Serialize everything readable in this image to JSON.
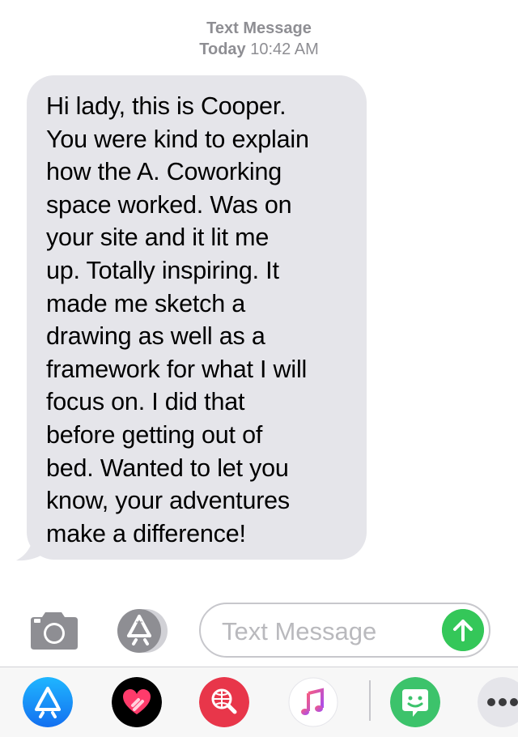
{
  "header": {
    "service": "Text Message",
    "day": "Today",
    "time": "10:42 AM"
  },
  "message": {
    "sender": "incoming",
    "text": "Hi lady, this is Cooper.\nYou were kind to explain\nhow the A. Coworking\nspace worked. Was on\nyour site and it lit me\nup. Totally inspiring. It\nmade me sketch a\ndrawing as well as a\nframework for what I will\nfocus on. I did that\nbefore getting out of\nbed. Wanted to let you\nknow, your adventures\nmake a difference!"
  },
  "composer": {
    "placeholder": "Text Message",
    "camera_icon": "camera-icon",
    "apps_icon": "app-store-icon",
    "send_icon": "arrow-up-icon",
    "send_color": "#34c759"
  },
  "app_drawer": {
    "apps": [
      {
        "icon": "app-store-icon",
        "color": "#1a8cff"
      },
      {
        "icon": "digital-touch-icon",
        "color": "#000000"
      },
      {
        "icon": "images-search-icon",
        "color": "#e8364a"
      },
      {
        "icon": "music-icon",
        "color": "#ffffff"
      },
      {
        "icon": "bitmoji-icon",
        "color": "#3cc36b"
      },
      {
        "icon": "more-icon",
        "color": "#e5e5ea"
      }
    ]
  },
  "colors": {
    "incoming_bubble": "#e5e5ea",
    "meta_text": "#8e8e93"
  }
}
